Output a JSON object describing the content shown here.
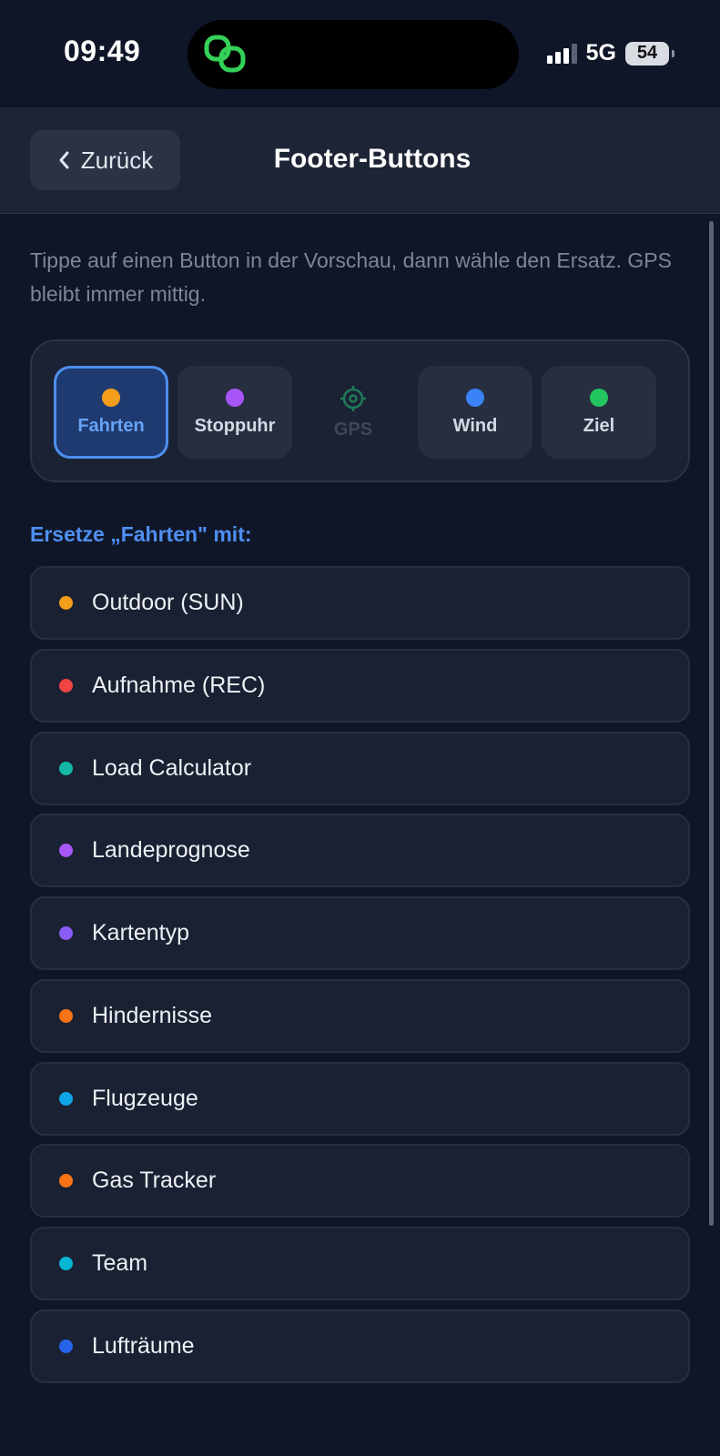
{
  "status_bar": {
    "time": "09:49",
    "network": "5G",
    "battery": "54"
  },
  "header": {
    "back_label": "Zurück",
    "title": "Footer-Buttons"
  },
  "hint": "Tippe auf einen Button in der Vorschau, dann wähle den Ersatz. GPS bleibt immer mittig.",
  "preview": {
    "buttons": [
      {
        "label": "Fahrten",
        "color": "#f59e1b",
        "selected": true
      },
      {
        "label": "Stoppuhr",
        "color": "#a855f7",
        "selected": false
      },
      {
        "label": "GPS",
        "color": "#1f7a5a",
        "fixed": true,
        "icon": "crosshair-icon"
      },
      {
        "label": "Wind",
        "color": "#3b82f6",
        "selected": false
      },
      {
        "label": "Ziel",
        "color": "#22c55e",
        "selected": false
      }
    ]
  },
  "section_label": "Ersetze „Fahrten\" mit:",
  "options": [
    {
      "label": "Outdoor (SUN)",
      "color": "#f59e1b"
    },
    {
      "label": "Aufnahme (REC)",
      "color": "#ef4444"
    },
    {
      "label": "Load Calculator",
      "color": "#14b8a6"
    },
    {
      "label": "Landeprognose",
      "color": "#a855f7"
    },
    {
      "label": "Kartentyp",
      "color": "#8b5cf6"
    },
    {
      "label": "Hindernisse",
      "color": "#f97316"
    },
    {
      "label": "Flugzeuge",
      "color": "#0ea5e9"
    },
    {
      "label": "Gas Tracker",
      "color": "#f97316"
    },
    {
      "label": "Team",
      "color": "#06b6d4"
    },
    {
      "label": "Lufträume",
      "color": "#2563eb"
    }
  ]
}
